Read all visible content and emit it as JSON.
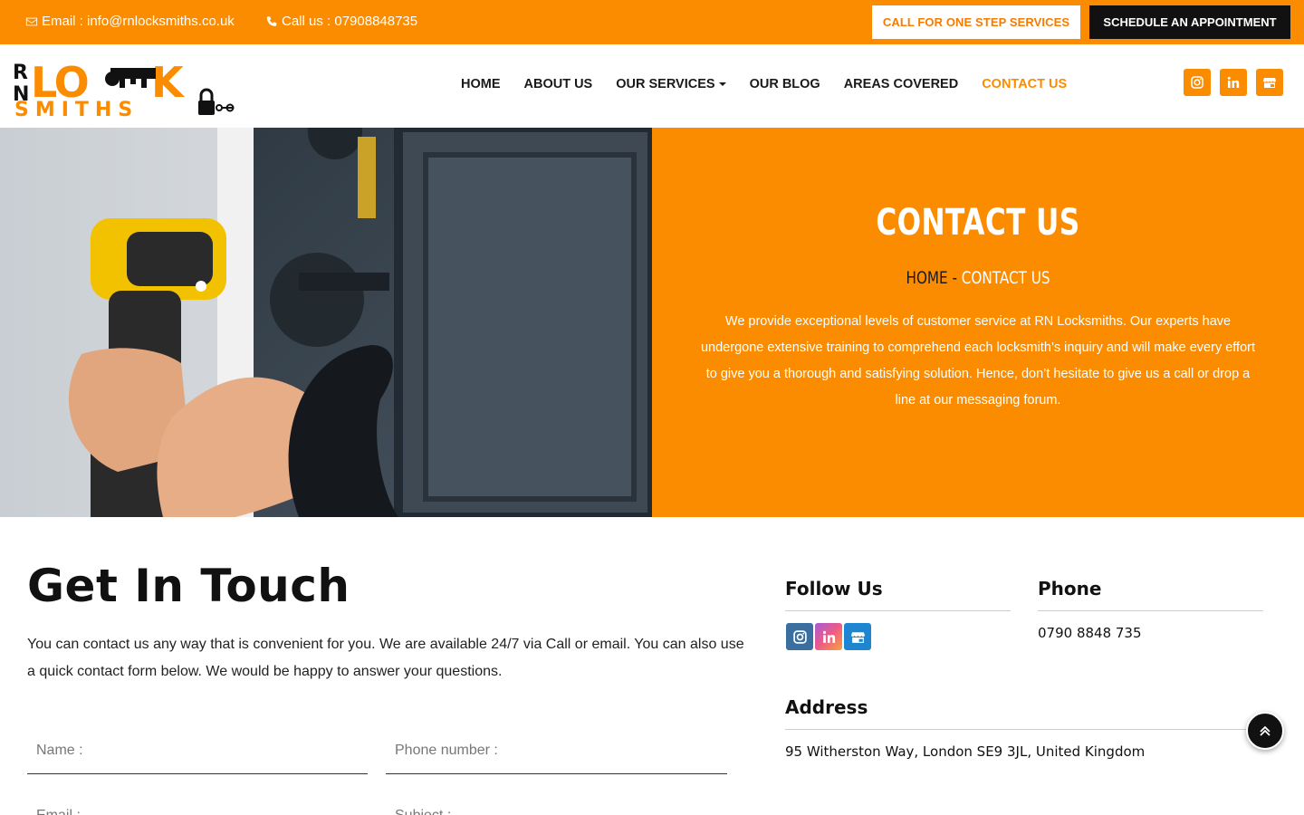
{
  "topbar": {
    "email_text": "Email : info@rnlocksmiths.co.uk",
    "phone_text": "Call us : 07908848735",
    "cta_call": "CALL FOR ONE STEP SERVICES",
    "cta_schedule": "SCHEDULE AN APPOINTMENT"
  },
  "logo": {
    "line1_left": "RN",
    "word1": "LOCK",
    "word2": "SMITHS"
  },
  "nav": {
    "home": "HOME",
    "about": "ABOUT US",
    "services": "OUR SERVICES",
    "blog": "OUR BLOG",
    "areas": "AREAS COVERED",
    "contact": "CONTACT US"
  },
  "header_social": [
    "instagram-icon",
    "linkedin-icon",
    "google-business-icon"
  ],
  "hero": {
    "title": "CONTACT US",
    "crumb_home": "HOME",
    "crumb_sep": "-",
    "crumb_current": "CONTACT US",
    "text": "We provide exceptional levels of customer service at RN Locksmiths. Our experts have undergone extensive training to comprehend each locksmith’s inquiry and will make every effort to give you a thorough and satisfying solution. Hence, don’t hesitate to give us a call or drop a line at our messaging forum."
  },
  "contact": {
    "title": "Get In Touch",
    "intro": "You can contact us any way that is convenient for you. We are available 24/7 via Call or email. You can also use a quick contact form below. We would be happy to answer your questions.",
    "form": {
      "name_placeholder": "Name :",
      "phone_placeholder": "Phone number :",
      "email_placeholder": "Email :",
      "subject_placeholder": "Subject :"
    }
  },
  "sidebar": {
    "follow_title": "Follow Us",
    "phone_title": "Phone",
    "phone_value": "0790 8848 735",
    "address_title": "Address",
    "address_value": "95 Witherston Way, London SE9 3JL, United Kingdom"
  },
  "colors": {
    "accent": "#fb8c00",
    "dark": "#111111",
    "white": "#ffffff"
  }
}
